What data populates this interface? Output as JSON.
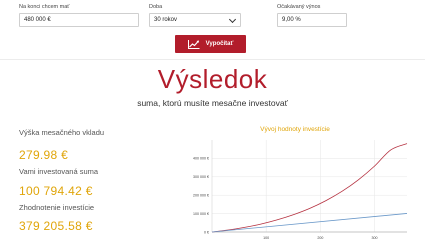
{
  "form": {
    "target_label": "Na konci chcem mať",
    "target_value": "480 000 €",
    "period_label": "Doba",
    "period_value": "30 rokov",
    "return_label": "Očakávaný výnos",
    "return_value": "9,00 %",
    "calculate_label": "Vypočítať"
  },
  "results": {
    "title": "Výsledok",
    "subtitle": "suma, ktorú musíte mesačne investovať",
    "monthly_label": "Výška mesačného vkladu",
    "monthly_value": "279.98 €",
    "invested_label": "Vami investovaná suma",
    "invested_value": "100 794.42 €",
    "gain_label": "Zhodnotenie investície",
    "gain_value": "379 205.58 €"
  },
  "colors": {
    "accent": "#b21d2b",
    "value": "#e0a50a",
    "line_total": "#b5303f",
    "line_invested": "#6a98c9"
  },
  "chart_data": {
    "type": "line",
    "title": "Vývoj hodnoty investície",
    "ylim": [
      0,
      500000
    ],
    "xlim": [
      0,
      360
    ],
    "y_ticks": [
      "0 €",
      "100 000 €",
      "200 000 €",
      "300 000 €",
      "400 000 €"
    ],
    "y_tick_values": [
      0,
      100000,
      200000,
      300000,
      400000
    ],
    "x_ticks": [
      "100",
      "200",
      "300"
    ],
    "x_tick_values": [
      100,
      200,
      300
    ],
    "grid": true,
    "series": [
      {
        "color": "#b5303f",
        "x": [
          0,
          30,
          60,
          90,
          120,
          150,
          180,
          210,
          240,
          270,
          300,
          330,
          360
        ],
        "y": [
          0,
          10500,
          25000,
          43000,
          66000,
          94000,
          128000,
          170000,
          221000,
          283000,
          358000,
          446000,
          480000
        ]
      },
      {
        "color": "#6a98c9",
        "x": [
          0,
          360
        ],
        "y": [
          0,
          100794
        ]
      }
    ]
  }
}
